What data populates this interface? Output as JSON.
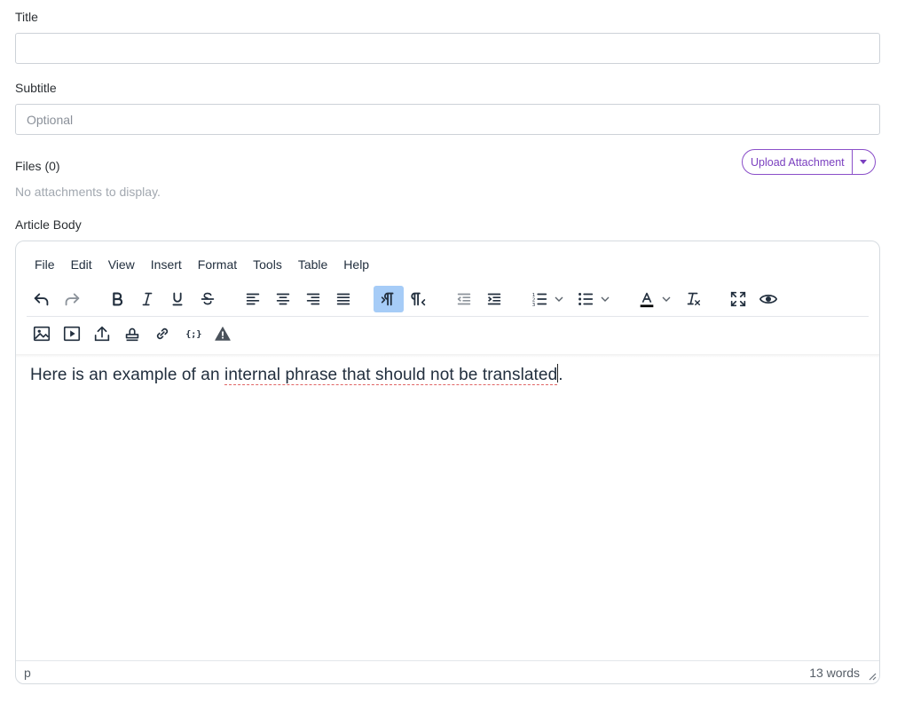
{
  "form": {
    "title_label": "Title",
    "title_value": "",
    "subtitle_label": "Subtitle",
    "subtitle_placeholder": "Optional",
    "files_label": "Files (0)",
    "files_empty": "No attachments to display.",
    "upload_label": "Upload Attachment",
    "body_label": "Article Body"
  },
  "editor": {
    "menu": [
      "File",
      "Edit",
      "View",
      "Insert",
      "Format",
      "Tools",
      "Table",
      "Help"
    ],
    "toolbar_row1": [
      "undo-icon",
      "redo-icon",
      "bold-icon",
      "italic-icon",
      "underline-icon",
      "strikethrough-icon",
      "align-left-icon",
      "align-center-icon",
      "align-right-icon",
      "align-justify-icon",
      "ltr-icon",
      "rtl-icon",
      "outdent-icon",
      "indent-icon",
      "numbered-list-icon",
      "bullet-list-icon",
      "text-color-icon",
      "clear-formatting-icon",
      "fullscreen-icon",
      "preview-icon"
    ],
    "toolbar_row2": [
      "image-icon",
      "media-icon",
      "upload-icon",
      "stamp-icon",
      "link-icon",
      "code-braces-icon",
      "warning-icon"
    ],
    "active_button": "ltr-icon",
    "content": {
      "before": "Here is an example of an ",
      "phrase": "internal phrase that should not be translated",
      "after": "."
    },
    "status_element": "p",
    "word_count": "13 words"
  },
  "colors": {
    "accent": "#7a3fbf",
    "active_button_bg": "#a6ccf7",
    "text_color_underline": "#000000"
  }
}
